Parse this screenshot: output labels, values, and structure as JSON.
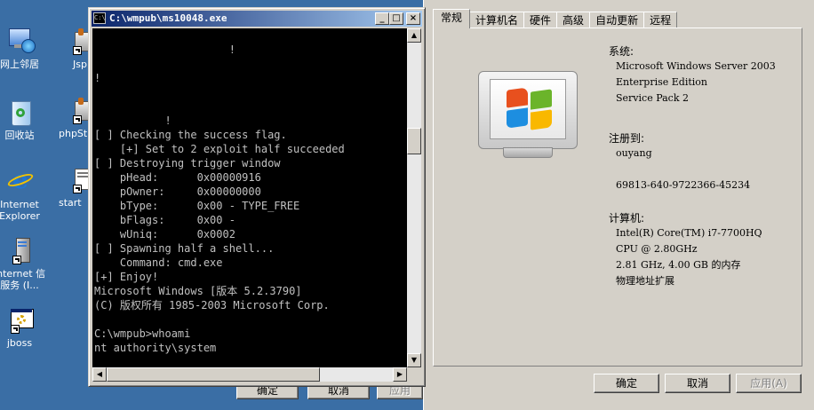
{
  "desktop": {
    "icons": [
      {
        "label_1": "网上邻居",
        "label_2": ""
      },
      {
        "label_1": "回收站",
        "label_2": ""
      },
      {
        "label_1": "Internet",
        "label_2": "Explorer"
      },
      {
        "label_1": "Internet 信",
        "label_2": "服务 (I..."
      },
      {
        "label_1": "jboss",
        "label_2": ""
      },
      {
        "label_1": "Jsp",
        "label_2": ""
      },
      {
        "label_1": "phpSt",
        "label_2": ""
      },
      {
        "label_1": "start",
        "label_2": ""
      }
    ]
  },
  "console": {
    "title": "C:\\wmpub\\ms10048.exe",
    "icon_text": "C:\\",
    "buttons": {
      "minimize": "_",
      "maximize": "□",
      "close": "×"
    },
    "lines": [
      "                     !",
      "!",
      "",
      "",
      "           !",
      "[ ] Checking the success flag.",
      "    [+] Set to 2 exploit half succeeded",
      "[ ] Destroying trigger window",
      "    pHead:      0x00000916",
      "    pOwner:     0x00000000",
      "    bType:      0x00 - TYPE_FREE",
      "    bFlags:     0x00 -",
      "    wUniq:      0x0002",
      "[ ] Spawning half a shell...",
      "    Command: cmd.exe",
      "[+] Enjoy!",
      "Microsoft Windows [版本 5.2.3790]",
      "(C) 版权所有 1985-2003 Microsoft Corp.",
      "",
      "C:\\wmpub>whoami",
      "nt authority\\system"
    ],
    "behind_buttons": [
      "确定",
      "取消",
      "应用"
    ]
  },
  "sysprops": {
    "tabs": [
      "常规",
      "计算机名",
      "硬件",
      "高级",
      "自动更新",
      "远程"
    ],
    "system_heading": "系统:",
    "os_name": "Microsoft Windows Server 2003",
    "edition": "Enterprise Edition",
    "service_pack": "Service Pack 2",
    "registered_heading": "注册到:",
    "registered_user": "ouyang",
    "product_id": "69813-640-9722366-45234",
    "computer_heading": "计算机:",
    "cpu_line1": "Intel(R) Core(TM) i7-7700HQ",
    "cpu_line2": "CPU @ 2.80GHz",
    "cpu_line3": "2.81 GHz, 4.00 GB 的内存",
    "cpu_line4": "物理地址扩展",
    "ok_label": "确定",
    "cancel_label": "取消",
    "apply_label": "应用(A)"
  }
}
